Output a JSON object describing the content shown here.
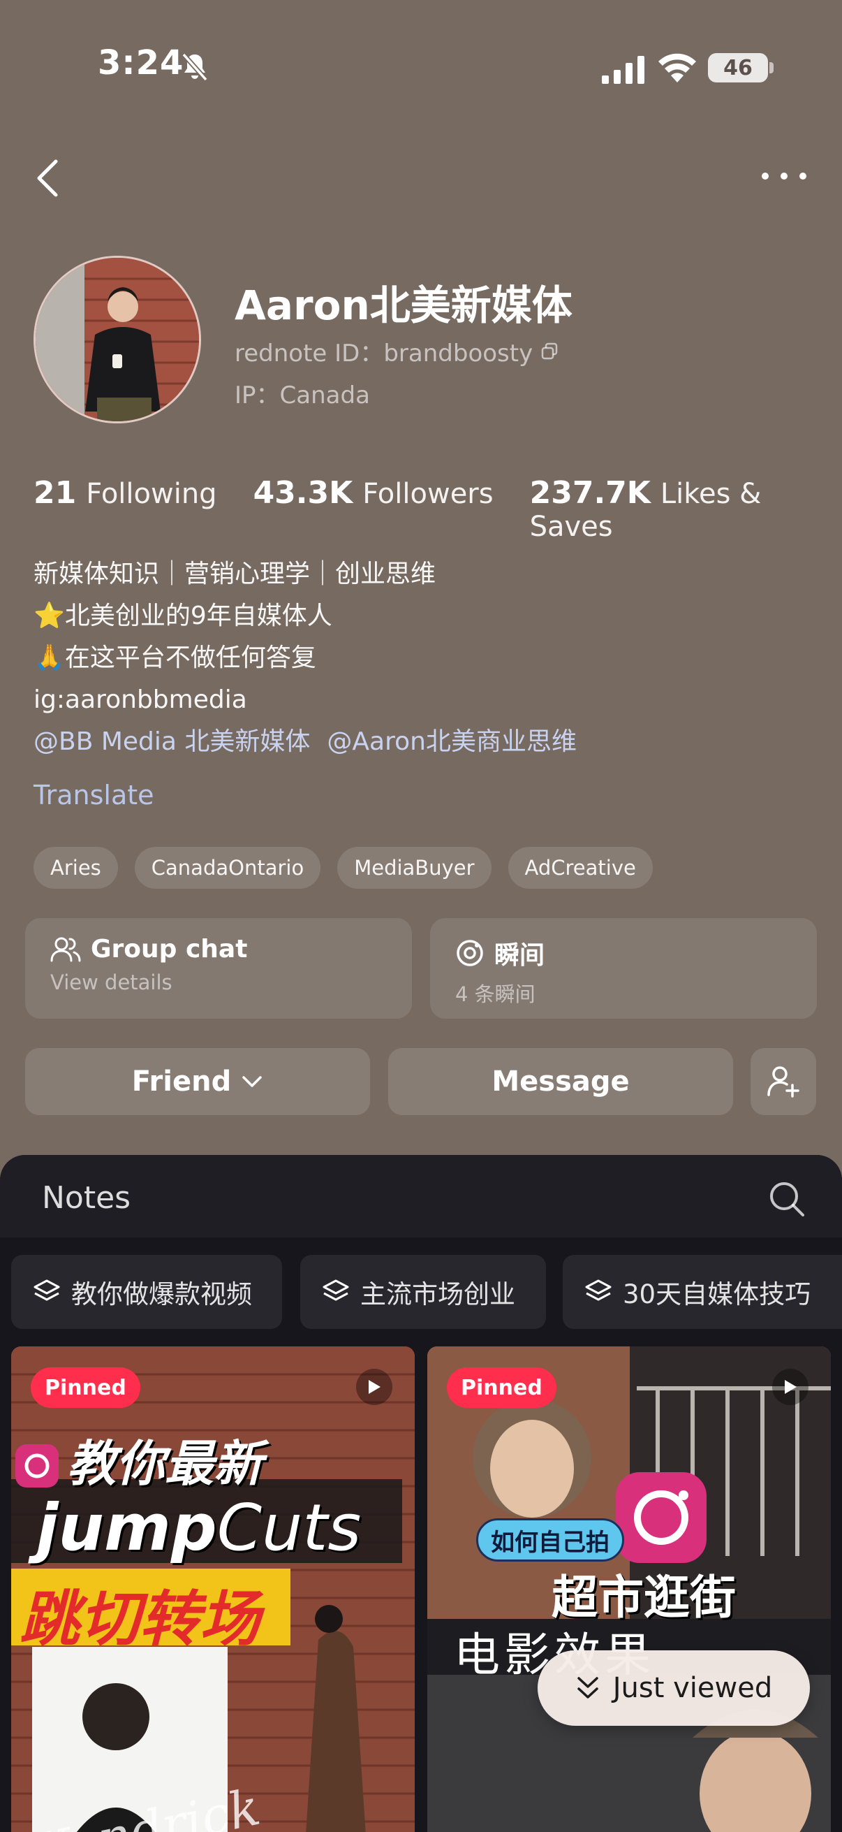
{
  "status_bar": {
    "time": "3:24",
    "battery": "46"
  },
  "profile": {
    "name": "Aaron北美新媒体",
    "rednote_id": "rednote ID：brandboosty",
    "ip": "IP：Canada"
  },
  "stats": {
    "following_count": "21",
    "following_label": "Following",
    "followers_count": "43.3K",
    "followers_label": "Followers",
    "likes_count": "237.7K",
    "likes_label": "Likes & Saves"
  },
  "bio": {
    "line1": "新媒体知识｜营销心理学｜创业思维",
    "line2_emoji": "⭐",
    "line2": "北美创业的9年自媒体人",
    "line3_emoji": "🙏",
    "line3": "在这平台不做任何答复",
    "line4": "ig:aaronbbmedia",
    "mention1": "@BB Media 北美新媒体",
    "mention2": "@Aaron北美商业思维"
  },
  "translate": "Translate",
  "tags": [
    "Aries",
    "CanadaOntario",
    "MediaBuyer",
    "AdCreative"
  ],
  "cards": {
    "group_title": "Group chat",
    "group_sub": "View details",
    "moment_title": "瞬间",
    "moment_sub": "4 条瞬间"
  },
  "actions": {
    "friend": "Friend",
    "message": "Message"
  },
  "notes": {
    "title": "Notes",
    "collections": [
      "教你做爆款视频",
      "主流市场创业",
      "30天自媒体技巧"
    ],
    "pinned_label": "Pinned",
    "thumb1": {
      "line1": "教你最新",
      "line2a": "jump",
      "line2b": "Cuts",
      "line3": "跳切转场",
      "script": "Kendrick"
    },
    "thumb2": {
      "bubble": "如何自己拍",
      "line1": "超市逛街",
      "line2": "电影效果"
    }
  },
  "just_viewed": "Just viewed",
  "colors": {
    "background": "#776a61",
    "panel": "#17161c",
    "pinned": "#ff2e4d",
    "link": "#b9c6e8"
  }
}
